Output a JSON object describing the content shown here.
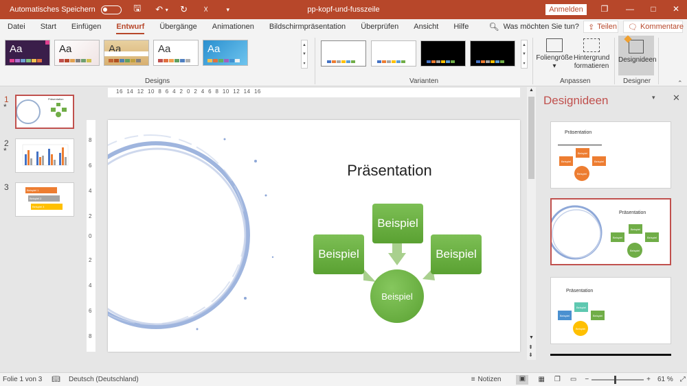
{
  "titlebar": {
    "autosave_label": "Automatisches Speichern",
    "doc_title": "pp-kopf-und-fusszeile",
    "signin": "Anmelden"
  },
  "menu": {
    "items": [
      "Datei",
      "Start",
      "Einfügen",
      "Entwurf",
      "Übergänge",
      "Animationen",
      "Bildschirmpräsentation",
      "Überprüfen",
      "Ansicht",
      "Hilfe"
    ],
    "active_index": 3,
    "search_placeholder": "Was möchten Sie tun?",
    "share": "Teilen",
    "comments": "Kommentare"
  },
  "ribbon": {
    "themes_label": "Designs",
    "theme_sample": "Aa",
    "variants_label": "Varianten",
    "customize_label": "Anpassen",
    "slide_size": "Foliengröße",
    "background_line1": "Hintergrund",
    "background_line2": "formatieren",
    "designer_label": "Designer",
    "design_ideas_btn": "Designideen"
  },
  "thumbnails": [
    {
      "number": "1",
      "star": "*"
    },
    {
      "number": "2",
      "star": "*"
    },
    {
      "number": "3",
      "star": ""
    }
  ],
  "thumb1": {
    "title": "Präsentation"
  },
  "thumb3": {
    "items": [
      "Beispiel 1",
      "Beispiel 2",
      "Beispiel 3"
    ]
  },
  "slide": {
    "title": "Präsentation",
    "boxes": {
      "top": "Beispiel",
      "left": "Beispiel",
      "right": "Beispiel",
      "center": "Beispiel"
    }
  },
  "pane": {
    "title": "Designideen",
    "idea_title": "Präsentation",
    "idea_box": "Beispiel"
  },
  "ruler": {
    "h_ticks": "16  14  12  10  8  6  4  2  0  2  4  6  8  10  12  14  16",
    "v_ticks": [
      "8",
      "6",
      "4",
      "2",
      "0",
      "2",
      "4",
      "6",
      "8"
    ]
  },
  "statusbar": {
    "slide_info": "Folie 1 von 3",
    "language": "Deutsch (Deutschland)",
    "notes": "Notizen",
    "zoom": "61 %"
  },
  "colors": {
    "brand": "#b7472a",
    "green": "#70ad47",
    "orange": "#ed7d31",
    "designer_active": "#c0504d"
  },
  "icons": [
    "save-icon",
    "undo-icon",
    "redo-icon",
    "present-icon",
    "search-icon",
    "share-icon",
    "comment-icon",
    "notes-icon",
    "normal-view-icon",
    "sorter-view-icon",
    "reading-view-icon",
    "slideshow-icon",
    "zoom-slider",
    "fit-icon"
  ]
}
